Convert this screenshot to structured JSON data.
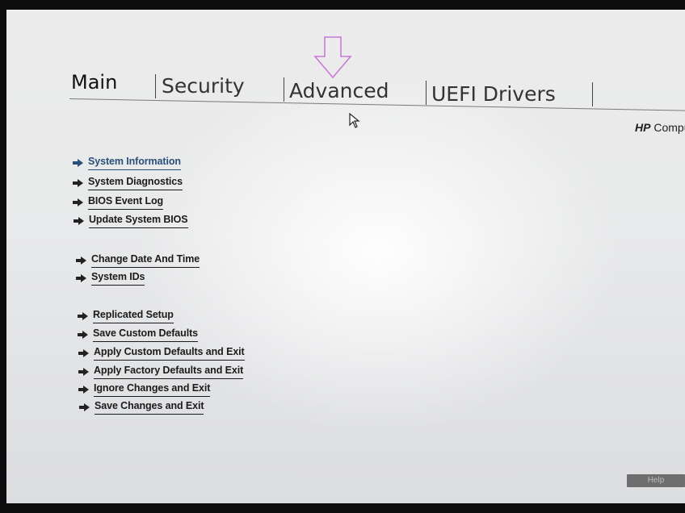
{
  "tabs": [
    {
      "label": "Main"
    },
    {
      "label": "Security"
    },
    {
      "label": "Advanced"
    },
    {
      "label": "UEFI Drivers"
    }
  ],
  "brand": {
    "bold": "HP",
    "rest": "Comput"
  },
  "menu": {
    "group1": [
      {
        "label": "System Information",
        "active": true
      },
      {
        "label": "System Diagnostics"
      },
      {
        "label": "BIOS Event Log"
      },
      {
        "label": "Update System BIOS"
      }
    ],
    "group2": [
      {
        "label": "Change Date And Time"
      },
      {
        "label": "System IDs"
      }
    ],
    "group3": [
      {
        "label": "Replicated Setup"
      },
      {
        "label": "Save Custom Defaults"
      },
      {
        "label": "Apply Custom Defaults and Exit"
      },
      {
        "label": "Apply Factory Defaults and Exit"
      },
      {
        "label": "Ignore Changes and Exit"
      },
      {
        "label": "Save Changes and Exit"
      }
    ]
  },
  "help": {
    "label": "Help"
  },
  "colors": {
    "active": "#2a4f7a",
    "annotation_arrow": "#c97bd6",
    "background": "#ececec"
  },
  "icons": {
    "menu_arrow": "right-arrow-icon",
    "annotation": "down-arrow-outline-icon",
    "pointer": "mouse-cursor-icon"
  }
}
